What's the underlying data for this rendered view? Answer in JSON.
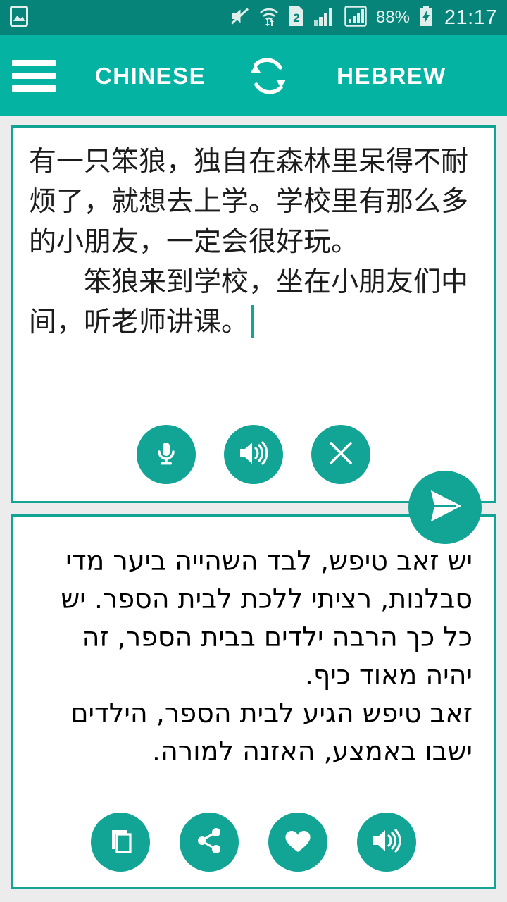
{
  "status_bar": {
    "background": "#07847a",
    "battery_percent": "88%",
    "clock": "21:17",
    "sim_label": "2",
    "icons": [
      "gallery-image-icon",
      "mute-icon",
      "wifi-icon",
      "sim2-icon",
      "signal-bars-icon",
      "signal-bars-boxed-icon",
      "battery-charging-icon"
    ]
  },
  "app_bar": {
    "background": "#05b3a2",
    "menu_icon": "hamburger-menu-icon",
    "source_language": "CHINESE",
    "swap_icon": "swap-languages-icon",
    "target_language": "HEBREW"
  },
  "accent_color": "#12a596",
  "source_card": {
    "text": "有一只笨狼，独自在森林里呆得不耐烦了，就想去上学。学校里有那么多的小朋友，一定会很好玩。\n　　笨狼来到学校，坐在小朋友们中间，听老师讲课。",
    "has_caret": true,
    "buttons": [
      {
        "name": "microphone-button",
        "icon": "microphone-icon",
        "label": "Voice input"
      },
      {
        "name": "speak-source-button",
        "icon": "speaker-icon",
        "label": "Listen"
      },
      {
        "name": "clear-text-button",
        "icon": "close-x-icon",
        "label": "Clear"
      }
    ]
  },
  "send_button": {
    "name": "translate-send-button",
    "icon": "send-paper-plane-icon",
    "label": "Translate"
  },
  "result_card": {
    "text": "יש זאב טיפש, לבד השהייה ביער מדי סבלנות, רציתי ללכת לבית הספר. יש כל כך הרבה ילדים בבית הספר, זה יהיה מאוד כיף.\nזאב טיפש הגיע לבית הספר, הילדים ישבו באמצע, האזנה למורה.",
    "direction": "rtl",
    "buttons": [
      {
        "name": "copy-button",
        "icon": "copy-icon",
        "label": "Copy"
      },
      {
        "name": "share-button",
        "icon": "share-icon",
        "label": "Share"
      },
      {
        "name": "favorite-button",
        "icon": "heart-icon",
        "label": "Favorite"
      },
      {
        "name": "speak-result-button",
        "icon": "speaker-icon",
        "label": "Listen"
      }
    ]
  }
}
